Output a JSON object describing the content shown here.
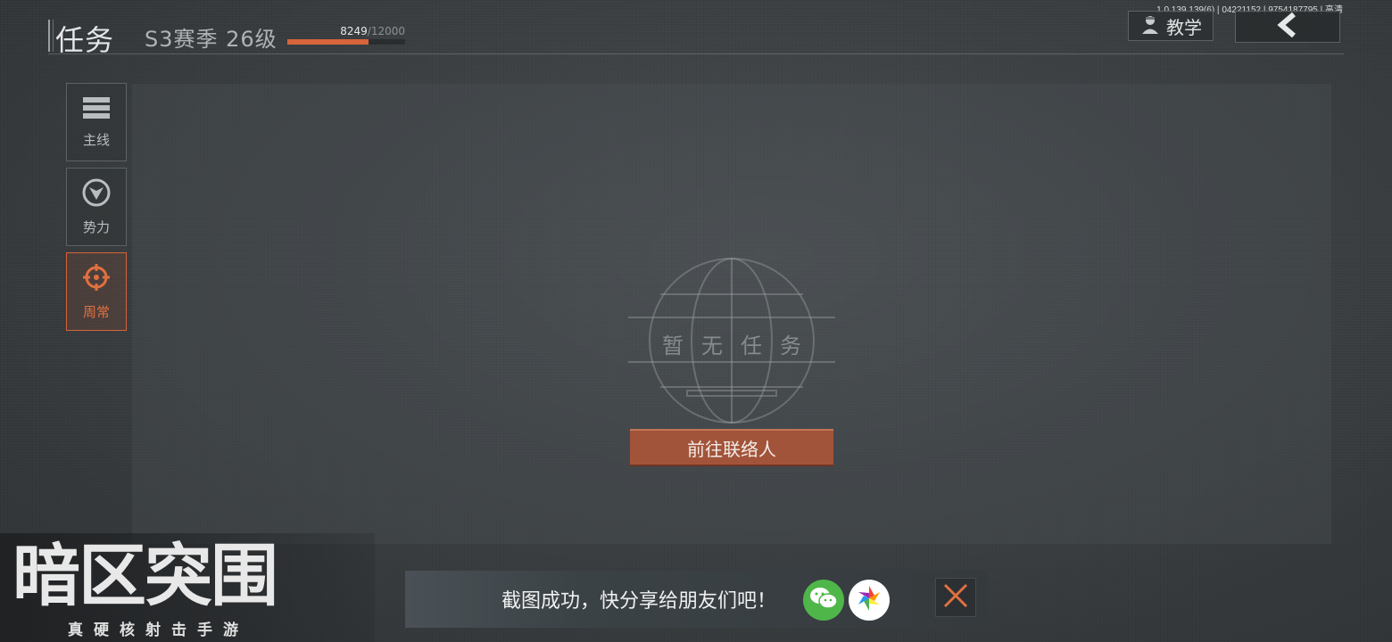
{
  "header": {
    "title": "任务",
    "season_label": "S3赛季 26级",
    "xp_current": "8249",
    "xp_max": "/12000",
    "xp_progress": 0.687,
    "version_info": "1.0.139.139(6) | 04221152 | 9754187795 | 高清",
    "tutorial_label": "教学"
  },
  "sidebar": {
    "items": [
      {
        "label": "主线",
        "icon": "list-icon",
        "active": false
      },
      {
        "label": "势力",
        "icon": "faction-emblem-icon",
        "active": false
      },
      {
        "label": "周常",
        "icon": "crosshair-icon",
        "active": true
      }
    ]
  },
  "main": {
    "empty_text": "暂无任务",
    "goto_contact_label": "前往联络人"
  },
  "logo": {
    "title": "暗区突围",
    "subtitle": "真硬核射击手游"
  },
  "toast": {
    "message": "截图成功，快分享给朋友们吧！",
    "share_targets": [
      "wechat-icon",
      "moments-icon"
    ]
  },
  "colors": {
    "accent": "#d7643b",
    "button": "#a2543a",
    "wechat": "#4fb64a"
  }
}
